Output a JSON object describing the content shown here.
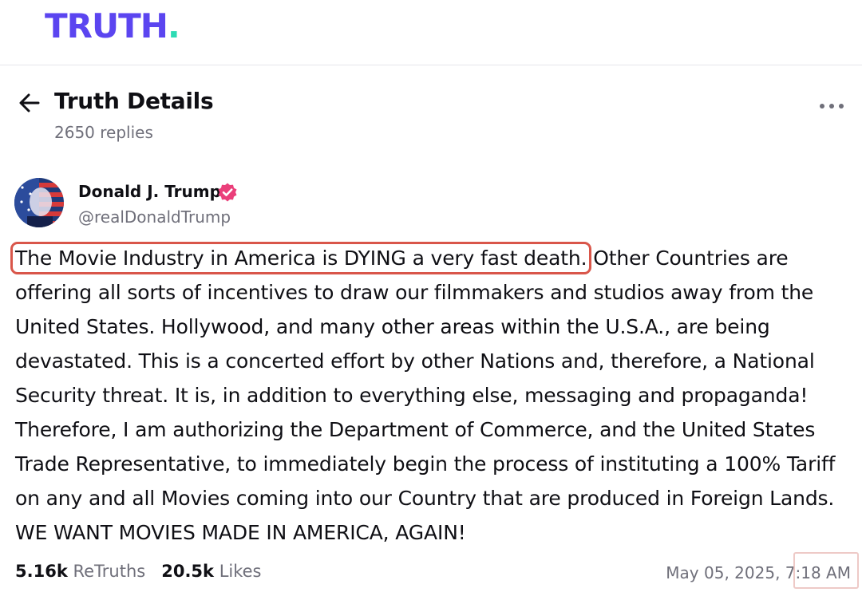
{
  "header": {
    "logo_text": "TRUTH",
    "logo_dot": ".",
    "brand_color": "#5b45f0",
    "accent_color": "#2ddbb4"
  },
  "page": {
    "back_icon": "arrow-left-icon",
    "title": "Truth Details",
    "replies": "2650 replies",
    "more_icon": "more-horizontal-icon"
  },
  "post": {
    "author_name": "Donald J. Trump",
    "author_handle": "@realDonaldTrump",
    "verified_icon": "verified-badge-icon",
    "verified_color": "#ea3f7a",
    "text_highlighted": "The Movie Industry in America is DYING a very fast death.",
    "text_rest": " Other Countries are offering all sorts of incentives to draw our filmmakers and studios away from the United States. Hollywood, and many other areas within the U.S.A., are being devastated. This is a concerted effort by other Nations and, therefore, a National Security threat. It is, in addition to everything else, messaging and propaganda! Therefore, I am authorizing the Department of Commerce, and the United States Trade Representative, to immediately begin the process of instituting a 100% Tariff on any and all Movies coming into our Country that are produced in Foreign Lands. WE WANT MOVIES MADE IN AMERICA, AGAIN!",
    "highlight_color": "#d9564a",
    "retruths_count": "5.16k",
    "retruths_label": "ReTruths",
    "likes_count": "20.5k",
    "likes_label": "Likes",
    "timestamp": "May 05, 2025, 7:18 AM"
  }
}
